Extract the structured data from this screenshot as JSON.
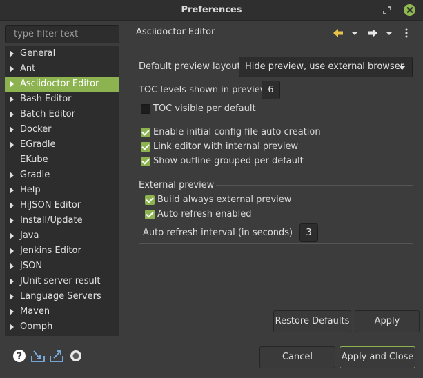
{
  "window": {
    "title": "Preferences"
  },
  "sidebar": {
    "filter_placeholder": "type filter text",
    "items": [
      {
        "label": "General",
        "expandable": true,
        "selected": false
      },
      {
        "label": "Ant",
        "expandable": true,
        "selected": false
      },
      {
        "label": "Asciidoctor Editor",
        "expandable": true,
        "selected": true
      },
      {
        "label": "Bash Editor",
        "expandable": true,
        "selected": false
      },
      {
        "label": "Batch Editor",
        "expandable": true,
        "selected": false
      },
      {
        "label": "Docker",
        "expandable": true,
        "selected": false
      },
      {
        "label": "EGradle",
        "expandable": true,
        "selected": false
      },
      {
        "label": "EKube",
        "expandable": false,
        "selected": false
      },
      {
        "label": "Gradle",
        "expandable": true,
        "selected": false
      },
      {
        "label": "Help",
        "expandable": true,
        "selected": false
      },
      {
        "label": "HiJSON Editor",
        "expandable": true,
        "selected": false
      },
      {
        "label": "Install/Update",
        "expandable": true,
        "selected": false
      },
      {
        "label": "Java",
        "expandable": true,
        "selected": false
      },
      {
        "label": "Jenkins Editor",
        "expandable": true,
        "selected": false
      },
      {
        "label": "JSON",
        "expandable": true,
        "selected": false
      },
      {
        "label": "JUnit server result",
        "expandable": true,
        "selected": false
      },
      {
        "label": "Language Servers",
        "expandable": true,
        "selected": false
      },
      {
        "label": "Maven",
        "expandable": true,
        "selected": false
      },
      {
        "label": "Oomph",
        "expandable": true,
        "selected": false
      }
    ]
  },
  "page": {
    "title": "Asciidoctor Editor",
    "preview_layout": {
      "label": "Default preview layout",
      "value": "Hide preview, use external browser"
    },
    "toc_levels": {
      "label": "TOC levels shown in preview",
      "value": "6"
    },
    "toc_visible": {
      "label": "TOC visible per default",
      "checked": false
    },
    "checks": [
      {
        "label": "Enable initial config file auto creation",
        "checked": true
      },
      {
        "label": "Link editor with internal preview",
        "checked": true
      },
      {
        "label": "Show outline grouped per default",
        "checked": true
      }
    ],
    "external_preview": {
      "title": "External preview",
      "build_always": {
        "label": "Build always external preview",
        "checked": true
      },
      "auto_refresh": {
        "label": "Auto refresh enabled",
        "checked": true
      },
      "interval": {
        "label": "Auto refresh interval (in seconds)",
        "value": "3"
      }
    }
  },
  "buttons": {
    "restore_defaults": "Restore Defaults",
    "apply": "Apply",
    "cancel": "Cancel",
    "apply_and_close": "Apply and Close"
  },
  "colors": {
    "accent": "#8cb350",
    "background": "#3c3c3c",
    "field": "#2d2d2d",
    "nav_arrow": "#e8c34a"
  },
  "icons": [
    "help-icon",
    "import-icon",
    "export-icon",
    "oomph-icon",
    "back-arrow-icon",
    "forward-arrow-icon",
    "view-menu-icon",
    "restore-window-icon",
    "close-window-icon"
  ]
}
